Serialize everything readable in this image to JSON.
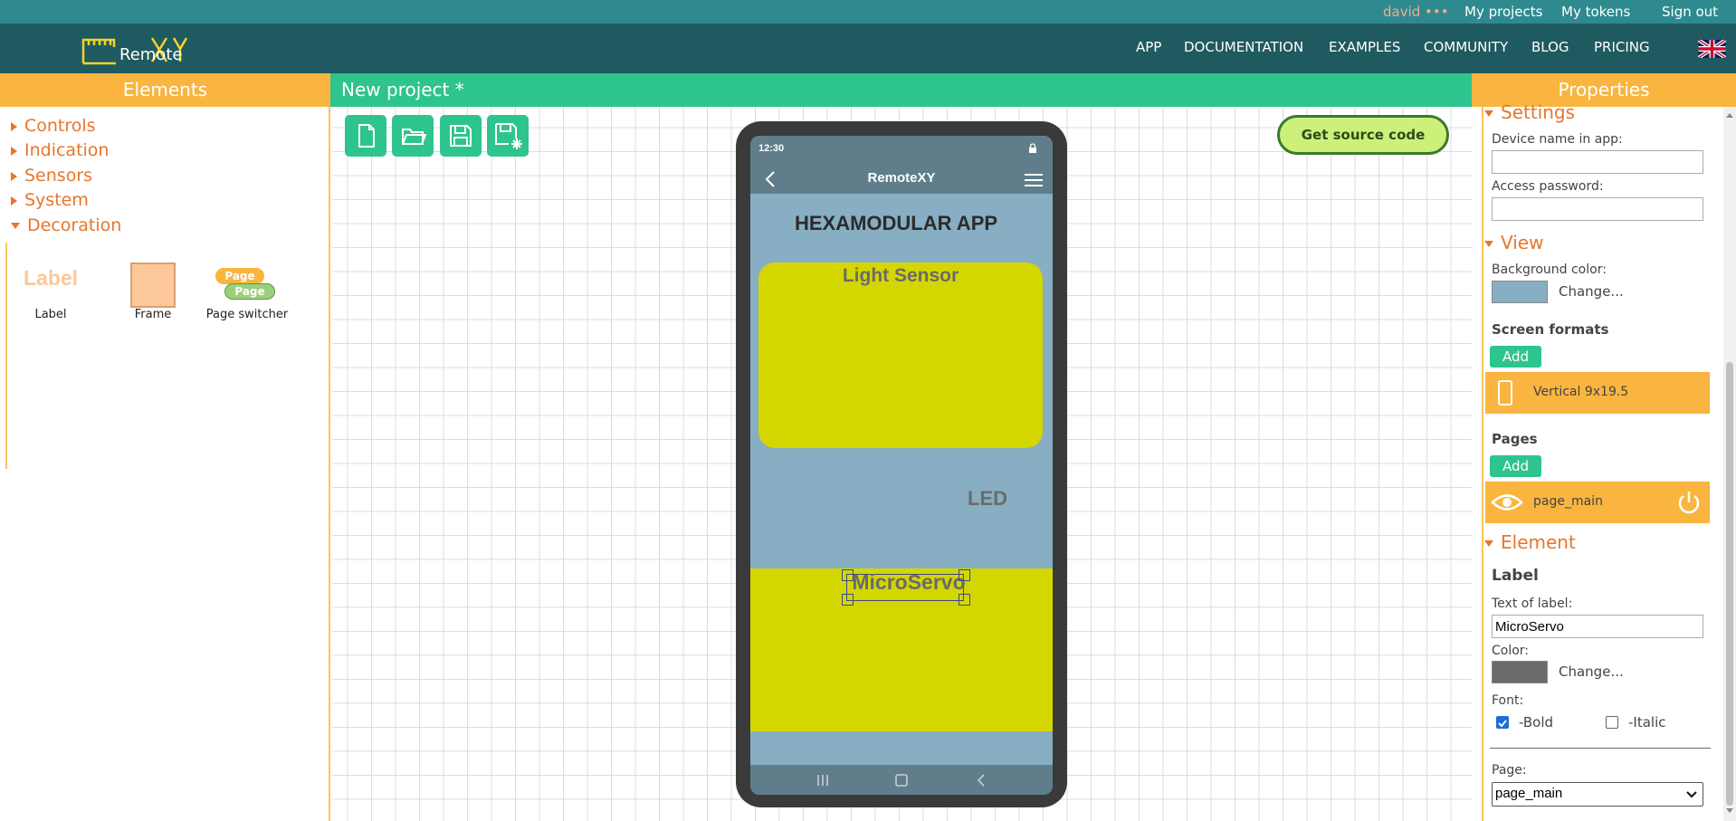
{
  "topbar": {
    "user": "david •••",
    "my_projects": "My projects",
    "my_tokens": "My tokens",
    "sign_out": "Sign out"
  },
  "logo": {
    "text": "Remote"
  },
  "nav": {
    "app": "APP",
    "documentation": "DOCUMENTATION",
    "examples": "EXAMPLES",
    "community": "COMMUNITY",
    "blog": "BLOG",
    "pricing": "PRICING",
    "language_icon": "uk-flag-icon"
  },
  "elements_panel": {
    "title": "Elements",
    "categories": [
      "Controls",
      "Indication",
      "Sensors",
      "System",
      "Decoration"
    ],
    "tools": [
      {
        "label": "Label",
        "preview": "Label"
      },
      {
        "label": "Frame"
      },
      {
        "label": "Page switcher",
        "preview": "Page"
      }
    ]
  },
  "project": {
    "title": "New project *",
    "toolbar_icons": [
      "new-file-icon",
      "open-folder-icon",
      "save-icon",
      "save-as-icon"
    ],
    "get_source_label": "Get source code"
  },
  "phone": {
    "time": "12:30",
    "app_title": "RemoteXY",
    "heading": "HEXAMODULAR APP",
    "light_sensor": "Light Sensor",
    "led": "LED",
    "micro_servo": "MicroServo",
    "colors": {
      "screen_bg": "#87aec2",
      "frame_fill": "#d4d600",
      "bar": "#607d8b"
    }
  },
  "properties": {
    "title": "Properties",
    "settings": {
      "header": "Settings",
      "device_name_label": "Device name in app:",
      "device_name_value": "",
      "access_password_label": "Access password:",
      "access_password_value": ""
    },
    "view": {
      "header": "View",
      "bg_color_label": "Background color:",
      "bg_color": "#87aec2",
      "change": "Change...",
      "screen_formats_label": "Screen formats",
      "add": "Add",
      "format": "Vertical 9x19.5",
      "pages_label": "Pages",
      "page": "page_main"
    },
    "element": {
      "header": "Element",
      "type": "Label",
      "text_label": "Text of label:",
      "text_value": "MicroServo",
      "color_label": "Color:",
      "color": "#6b6b6b",
      "change": "Change...",
      "font_label": "Font:",
      "bold_label": "-Bold",
      "bold_checked": true,
      "italic_label": "-Italic",
      "italic_checked": false,
      "page_label": "Page:",
      "page_value": "page_main"
    }
  }
}
